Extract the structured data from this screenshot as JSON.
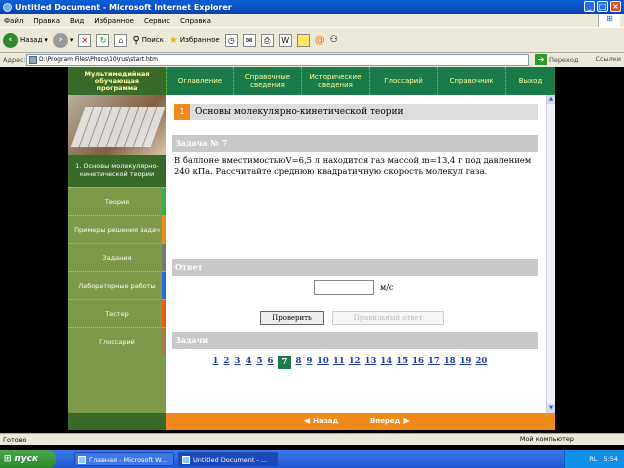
{
  "window": {
    "title": "Untitled Document - Microsoft Internet Explorer"
  },
  "menu": [
    "Файл",
    "Правка",
    "Вид",
    "Избранное",
    "Сервис",
    "Справка"
  ],
  "toolbar": {
    "back": "Назад",
    "search": "Поиск",
    "favorites": "Избранное"
  },
  "address": {
    "label": "Адрес:",
    "value": "D:\\Program Files\\Phscs\\10\\rus\\start.htm",
    "go": "Переход",
    "links": "Ссылки"
  },
  "app": {
    "brand": [
      "Мультимедийная",
      "обучающая",
      "программа"
    ],
    "nav": [
      {
        "label": "Оглавление"
      },
      {
        "label": "Справочные сведения"
      },
      {
        "label": "Исторические сведения"
      },
      {
        "label": "Глоссарий"
      },
      {
        "label": "Справочник"
      },
      {
        "label": "Выход"
      }
    ],
    "section_title": "1. Основы молекулярно-кинетической теории",
    "sidebar": [
      "Теория",
      "Примеры решения задач",
      "Задания",
      "Лабораторные работы",
      "Тестер",
      "Глоссарий"
    ],
    "heading_num": "1",
    "heading": "Основы молекулярно-кинетической теории",
    "task_head": "Задача № 7",
    "task_text": "В баллоне вместимостьюV=6,5 л находится газ массой m=13,4 г под давлением 240 кПа. Рассчитайте среднюю квадратичную скорость молекул газа.",
    "answer_head": "Ответ",
    "answer_value": "",
    "unit": "м/с",
    "check_btn": "Проверить",
    "right_btn": "Правильный ответ",
    "tasks_head": "Задачи",
    "pages": [
      "1",
      "2",
      "3",
      "4",
      "5",
      "6",
      "7",
      "8",
      "9",
      "10",
      "11",
      "12",
      "13",
      "14",
      "15",
      "16",
      "17",
      "18",
      "19",
      "20"
    ],
    "current_page": "7",
    "back": "Назад",
    "forward": "Вперед"
  },
  "status": {
    "left": "Готово",
    "right": "Мой компьютер"
  },
  "taskbar": {
    "start": "пуск",
    "tasks": [
      "Главная - Microsoft W...",
      "Untitled Document - ..."
    ],
    "lang": "RL",
    "time": "5:54"
  },
  "colors": {
    "green": "#1a7a4a",
    "orange": "#f08a1a",
    "side": "#7d9a48"
  }
}
